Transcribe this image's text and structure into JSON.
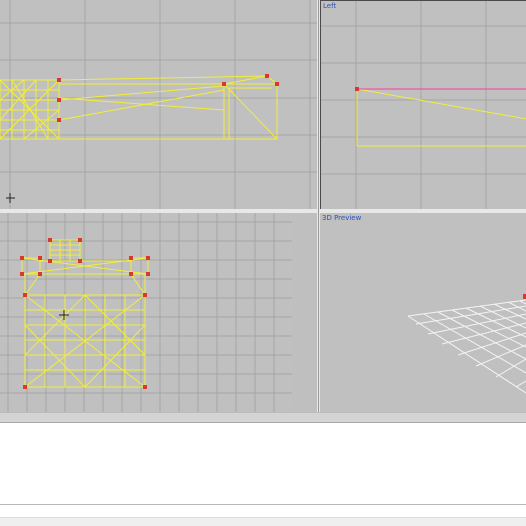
{
  "viewports": {
    "top": {
      "label": ""
    },
    "left": {
      "label": "Left"
    },
    "front": {
      "label": ""
    },
    "preview": {
      "label": "3D Preview"
    }
  },
  "colors": {
    "viewport_bg": "#c0c0c0",
    "grid": "#a6a6a6",
    "wire": "#f2ee3a",
    "vertex": "#d9382a",
    "selected_edge": "#ff3aa0",
    "label": "#2b55b8"
  }
}
